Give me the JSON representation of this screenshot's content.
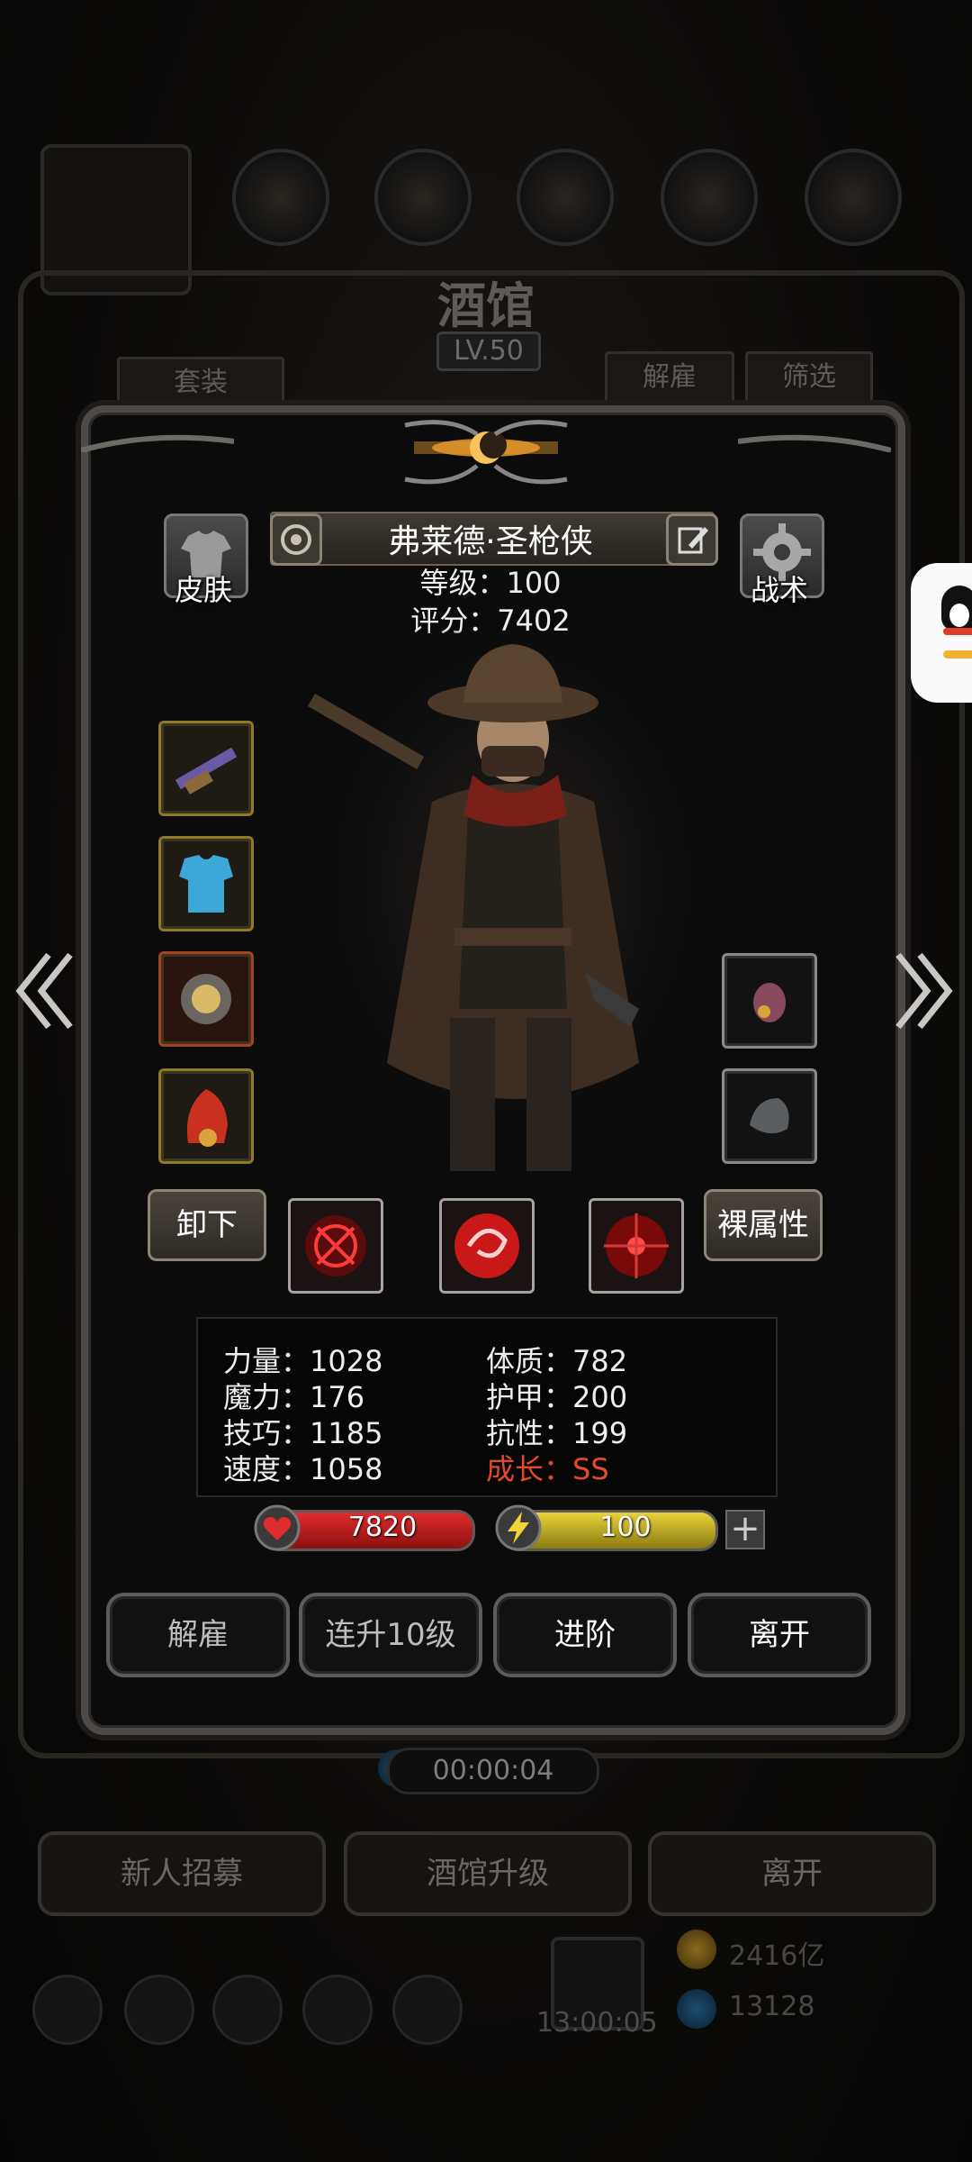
{
  "background": {
    "title": "酒馆",
    "level": "LV.50",
    "suit_button": "套装",
    "dismiss_button": "解雇",
    "filter_button": "筛选",
    "timer": "00:00:04",
    "bottom_buttons": [
      "新人招募",
      "酒馆升级",
      "离开"
    ],
    "resource_gold": "2416亿",
    "resource_gem": "13128",
    "gift_timer": "13:00:05"
  },
  "hero": {
    "name": "弗莱德·圣枪侠",
    "level_text": "等级：100",
    "score_text": "评分：7402",
    "skin_button": "皮肤",
    "tactics_button": "战术",
    "unequip_button": "卸下",
    "bare_stats_button": "裸属性"
  },
  "stats": {
    "strength": "力量：1028",
    "magic": "魔力：176",
    "skill": "技巧：1185",
    "speed": "速度：1058",
    "constitution": "体质：782",
    "armor": "护甲：200",
    "resistance": "抗性：199",
    "growth": "成长：SS"
  },
  "bars": {
    "hp": "7820",
    "energy": "100"
  },
  "actions": {
    "dismiss": "解雇",
    "level_up_10": "连升10级",
    "advance": "进阶",
    "leave": "离开"
  },
  "icons": [
    "heart-icon",
    "lightning-icon",
    "plus-icon",
    "gear-icon",
    "shirt-icon",
    "edit-icon",
    "badge-icon"
  ],
  "colors": {
    "growth_red": "#e34a2a",
    "hp_red": "#e02c2c",
    "energy_yellow": "#e8d43a"
  }
}
